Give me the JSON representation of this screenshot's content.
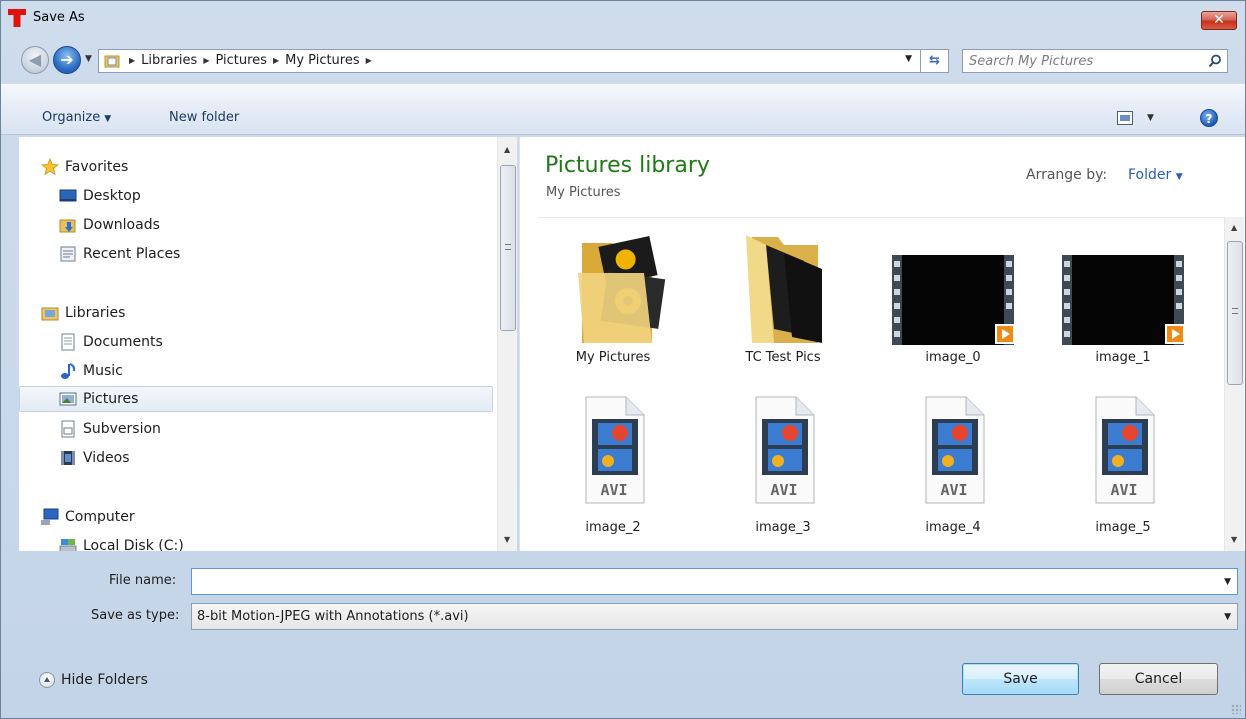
{
  "window": {
    "title": "Save As",
    "close_label": "✕"
  },
  "address": {
    "crumbs": [
      "Libraries",
      "Pictures",
      "My Pictures"
    ],
    "search_placeholder": "Search My Pictures"
  },
  "toolbar": {
    "organize_label": "Organize",
    "new_folder_label": "New folder",
    "help_label": "?"
  },
  "nav": {
    "items": [
      {
        "label": "Favorites",
        "icon": "star-icon",
        "group": true
      },
      {
        "label": "Desktop",
        "icon": "desktop-icon"
      },
      {
        "label": "Downloads",
        "icon": "downloads-folder-icon"
      },
      {
        "label": "Recent Places",
        "icon": "recent-places-icon"
      },
      {
        "label": "Libraries",
        "icon": "libraries-icon",
        "group": true
      },
      {
        "label": "Documents",
        "icon": "documents-icon"
      },
      {
        "label": "Music",
        "icon": "music-icon"
      },
      {
        "label": "Pictures",
        "icon": "pictures-icon",
        "selected": true
      },
      {
        "label": "Subversion",
        "icon": "subversion-icon"
      },
      {
        "label": "Videos",
        "icon": "videos-icon"
      },
      {
        "label": "Computer",
        "icon": "computer-icon",
        "group": true
      },
      {
        "label": "Local Disk (C:)",
        "icon": "local-disk-icon"
      }
    ]
  },
  "content": {
    "library_title": "Pictures library",
    "library_subtitle": "My Pictures",
    "arrange_label": "Arrange by:",
    "arrange_value": "Folder",
    "items": [
      {
        "label": "My Pictures",
        "kind": "folder-pictures"
      },
      {
        "label": "TC Test Pics",
        "kind": "folder-dark"
      },
      {
        "label": "image_0",
        "kind": "video"
      },
      {
        "label": "image_1",
        "kind": "video"
      },
      {
        "label": "image_2",
        "kind": "avi"
      },
      {
        "label": "image_3",
        "kind": "avi"
      },
      {
        "label": "image_4",
        "kind": "avi"
      },
      {
        "label": "image_5",
        "kind": "avi"
      }
    ],
    "avi_badge": "AVI"
  },
  "form": {
    "file_name_label": "File name:",
    "file_name_value": "",
    "save_type_label": "Save as type:",
    "save_type_value": "8-bit Motion-JPEG with Annotations (*.avi)"
  },
  "footer": {
    "hide_folders_label": "Hide Folders",
    "save_label": "Save",
    "cancel_label": "Cancel"
  },
  "colors": {
    "accent_green": "#1f7a17",
    "link_blue": "#2a5fb5",
    "close_red": "#c7321c"
  }
}
